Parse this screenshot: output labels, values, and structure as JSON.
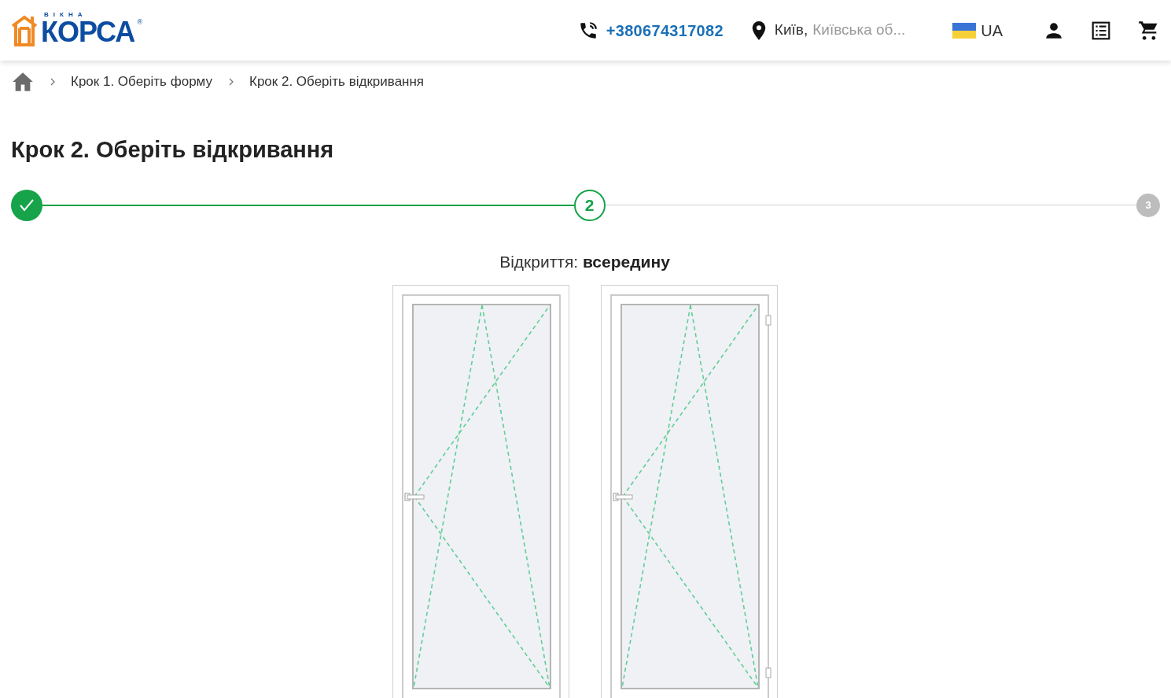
{
  "header": {
    "logo": {
      "tagline": "ВІКНА",
      "brand": "КОРСА",
      "registered": "®"
    },
    "phone": "+380674317082",
    "location": {
      "city": "Київ,",
      "region": "Київська об..."
    },
    "language": "UA"
  },
  "breadcrumbs": [
    "Крок 1. Оберіть форму",
    "Крок 2. Оберіть відкривання"
  ],
  "title": "Крок 2. Оберіть відкривання",
  "steps": [
    {
      "kind": "done"
    },
    {
      "kind": "current",
      "label": "2"
    },
    {
      "kind": "pending",
      "label": "3"
    }
  ],
  "opening": {
    "label": "Відкриття:",
    "value": "всередину"
  },
  "options": [
    {
      "hinges_visible": false
    },
    {
      "hinges_visible": true
    }
  ]
}
